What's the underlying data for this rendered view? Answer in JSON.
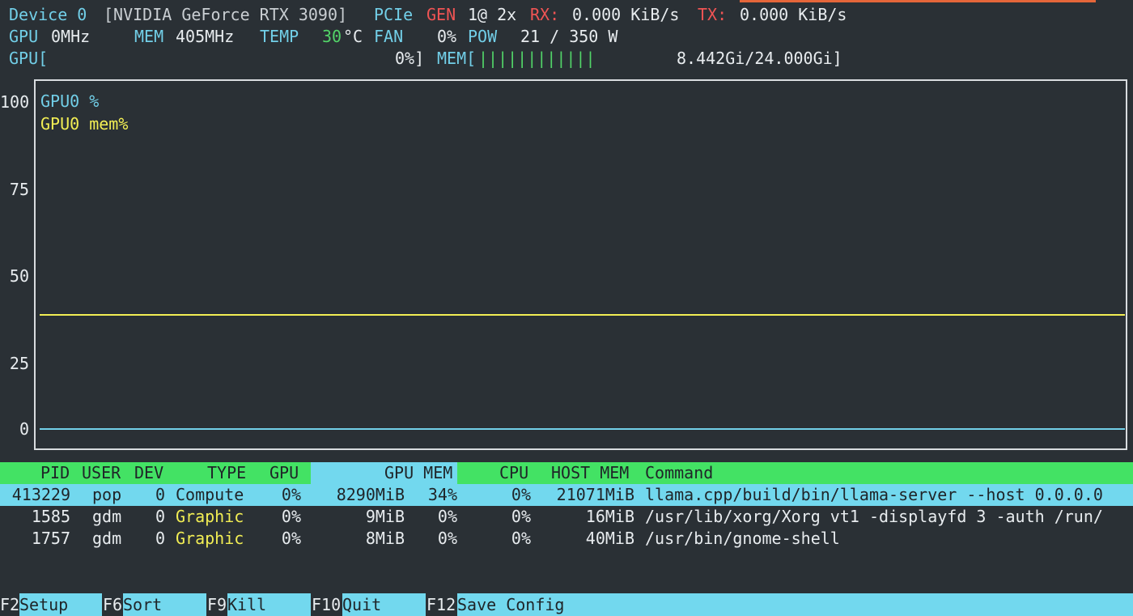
{
  "device": {
    "label": "Device 0",
    "name": "[NVIDIA GeForce RTX 3090]",
    "pcie_label": "PCIe",
    "gen_label": "GEN",
    "gen_value": "1@ 2x",
    "rx_label": "RX:",
    "rx_value": "0.000 KiB/s",
    "tx_label": "TX:",
    "tx_value": "0.000 KiB/s"
  },
  "stats": {
    "gpu_label": "GPU",
    "gpu_clock": "0MHz",
    "mem_label": "MEM",
    "mem_clock": "405MHz",
    "temp_label": "TEMP",
    "temp_value": "30",
    "temp_unit": "°C",
    "fan_label": "FAN",
    "fan_value": "0%",
    "pow_label": "POW",
    "pow_value": "21 / 350 W"
  },
  "bars": {
    "gpu_label": "GPU[",
    "gpu_value": "0%]",
    "gpu_util": 0,
    "mem_label": "MEM[",
    "mem_bar": "||||||||||||",
    "mem_value": "8.442Gi/24.000Gi]",
    "mem_used_fraction": 0.352
  },
  "chart_data": {
    "type": "line",
    "ylim": [
      0,
      100
    ],
    "yticks": [
      "100",
      "75",
      "50",
      "25",
      "0"
    ],
    "series": [
      {
        "name": "GPU0 %",
        "color": "#72cfe8",
        "values": [
          0
        ]
      },
      {
        "name": "GPU0 mem%",
        "color": "#f2ee54",
        "values": [
          35
        ]
      }
    ]
  },
  "table": {
    "headers": {
      "pid": "PID",
      "user": "USER",
      "dev": "DEV",
      "type": "TYPE",
      "gpu": "GPU",
      "gpu_mem": "GPU MEM",
      "cpu": "CPU",
      "host_mem": "HOST MEM",
      "command": "Command"
    },
    "rows": [
      {
        "pid": "413229",
        "user": "pop",
        "dev": "0",
        "type": "Compute",
        "gpu": "0%",
        "gpu_mem": "8290MiB",
        "gpu_mem_pct": "34%",
        "cpu": "0%",
        "host_mem": "21071MiB",
        "command": "llama.cpp/build/bin/llama-server --host 0.0.0.0"
      },
      {
        "pid": "1585",
        "user": "gdm",
        "dev": "0",
        "type": "Graphic",
        "gpu": "0%",
        "gpu_mem": "9MiB",
        "gpu_mem_pct": "0%",
        "cpu": "0%",
        "host_mem": "16MiB",
        "command": "/usr/lib/xorg/Xorg vt1 -displayfd 3 -auth /run/"
      },
      {
        "pid": "1757",
        "user": "gdm",
        "dev": "0",
        "type": "Graphic",
        "gpu": "0%",
        "gpu_mem": "8MiB",
        "gpu_mem_pct": "0%",
        "cpu": "0%",
        "host_mem": "40MiB",
        "command": "/usr/bin/gnome-shell"
      }
    ]
  },
  "footer": {
    "setup_key": "F2",
    "setup_label": "Setup",
    "sort_key": "F6",
    "sort_label": "Sort",
    "kill_key": "F9",
    "kill_label": "Kill",
    "quit_key": "F10",
    "quit_label": "Quit",
    "save_key": "F12",
    "save_label": "Save Config"
  }
}
